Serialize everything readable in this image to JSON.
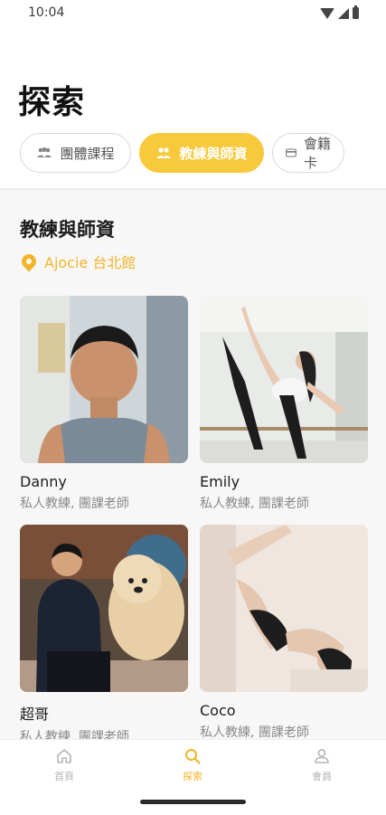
{
  "status_bar": {
    "time": "10:04"
  },
  "page": {
    "title": "探索"
  },
  "filter_tabs": [
    {
      "label": "團體課程",
      "icon": "group-icon",
      "selected": false
    },
    {
      "label": "教練與師資",
      "icon": "people-icon",
      "selected": true
    },
    {
      "label": "會籍卡",
      "icon": "card-icon",
      "selected": false
    }
  ],
  "section": {
    "title": "教練與師資",
    "location": "Ajocie 台北館",
    "location_icon": "location-pin-icon"
  },
  "coaches": [
    {
      "name": "Danny",
      "roles": "私人教練, 團課老師"
    },
    {
      "name": "Emily",
      "roles": "私人教練, 團課老師"
    },
    {
      "name": "超哥",
      "roles": "私人教練, 團課老師"
    },
    {
      "name": "Coco",
      "roles": "私人教練, 團課老師"
    }
  ],
  "bottom_nav": [
    {
      "label": "首頁",
      "icon": "home-icon",
      "active": false
    },
    {
      "label": "探索",
      "icon": "search-icon",
      "active": true
    },
    {
      "label": "會員",
      "icon": "user-icon",
      "active": false
    }
  ],
  "colors": {
    "accent": "#f7c93c",
    "accent_text": "#f2b52a"
  }
}
